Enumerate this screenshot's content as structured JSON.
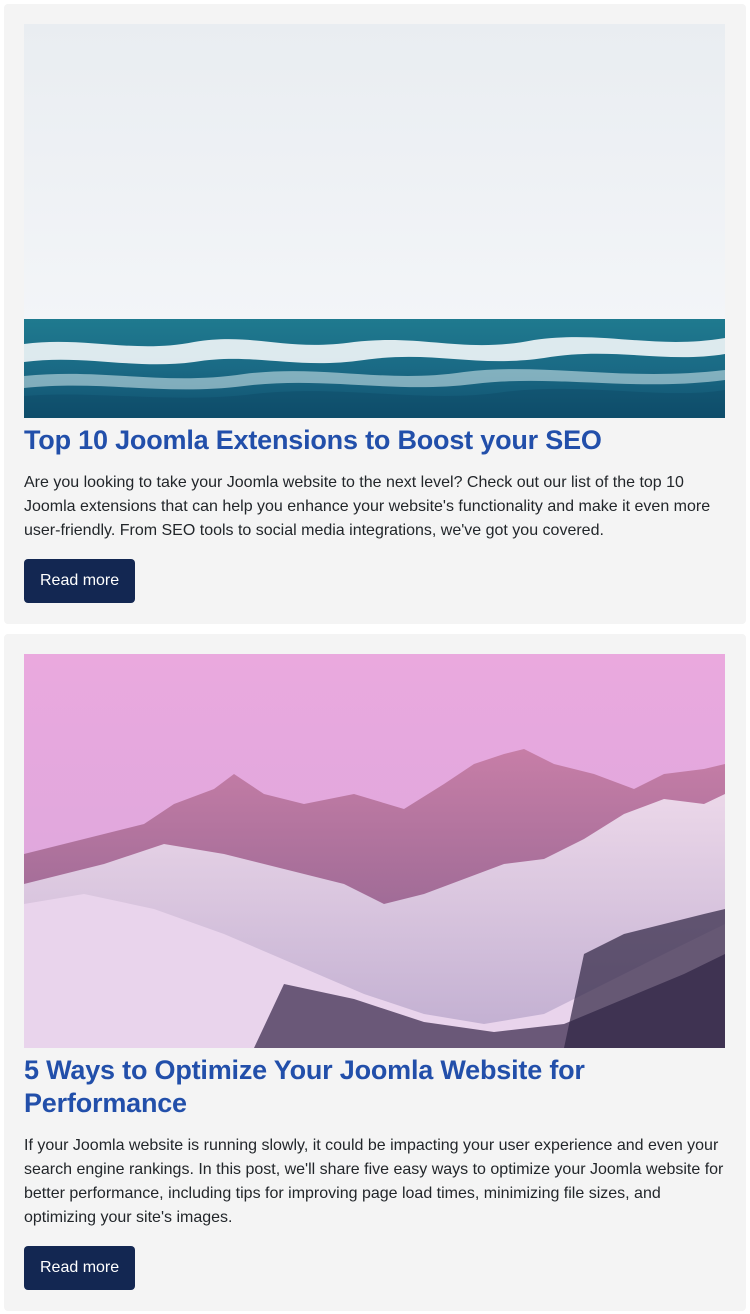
{
  "articles": [
    {
      "image": "ocean-waves-photo",
      "title": "Top 10 Joomla Extensions to Boost your SEO",
      "text": "Are you looking to take your Joomla website to the next level? Check out our list of the top 10 Joomla extensions that can help you enhance your website's functionality and make it even more user-friendly. From SEO tools to social media integrations, we've got you covered.",
      "button_label": "Read more"
    },
    {
      "image": "pink-snowy-mountains-photo",
      "title": "5 Ways to Optimize Your Joomla Website for Performance",
      "text": "If your Joomla website is running slowly, it could be impacting your user experience and even your search engine rankings. In this post, we'll share five easy ways to optimize your Joomla website for better performance, including tips for improving page load times, minimizing file sizes, and optimizing your site's images.",
      "button_label": "Read more"
    }
  ],
  "colors": {
    "title": "#224faa",
    "button_bg": "#132752",
    "card_bg": "#f4f4f4"
  }
}
